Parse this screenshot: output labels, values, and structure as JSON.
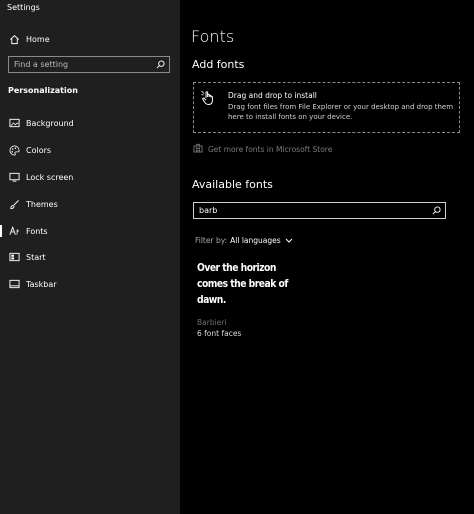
{
  "window": {
    "title": "Settings"
  },
  "sidebar": {
    "home_label": "Home",
    "search_placeholder": "Find a setting",
    "section_title": "Personalization",
    "items": [
      {
        "label": "Background",
        "icon": "image-icon"
      },
      {
        "label": "Colors",
        "icon": "palette-icon"
      },
      {
        "label": "Lock screen",
        "icon": "lock-screen-icon"
      },
      {
        "label": "Themes",
        "icon": "brush-icon"
      },
      {
        "label": "Fonts",
        "icon": "fonts-icon",
        "active": true
      },
      {
        "label": "Start",
        "icon": "start-icon"
      },
      {
        "label": "Taskbar",
        "icon": "taskbar-icon"
      }
    ]
  },
  "main": {
    "title": "Fonts",
    "add_fonts_heading": "Add fonts",
    "drop_title": "Drag and drop to install",
    "drop_description": "Drag font files from File Explorer or your desktop and drop them here to install fonts on your device.",
    "store_link": "Get more fonts in Microsoft Store",
    "available_heading": "Available fonts",
    "search_value": "barb",
    "filter_label": "Filter by:",
    "filter_value": "All languages",
    "font": {
      "preview_line1": "Over the horizon",
      "preview_line2": "comes the break of",
      "preview_line3": "dawn.",
      "name": "Barbieri",
      "faces": "6 font faces"
    }
  },
  "colors": {
    "sidebar_bg": "#1f1f1f",
    "main_bg": "#000000",
    "text": "#ffffff",
    "muted": "#7a7a7a"
  }
}
